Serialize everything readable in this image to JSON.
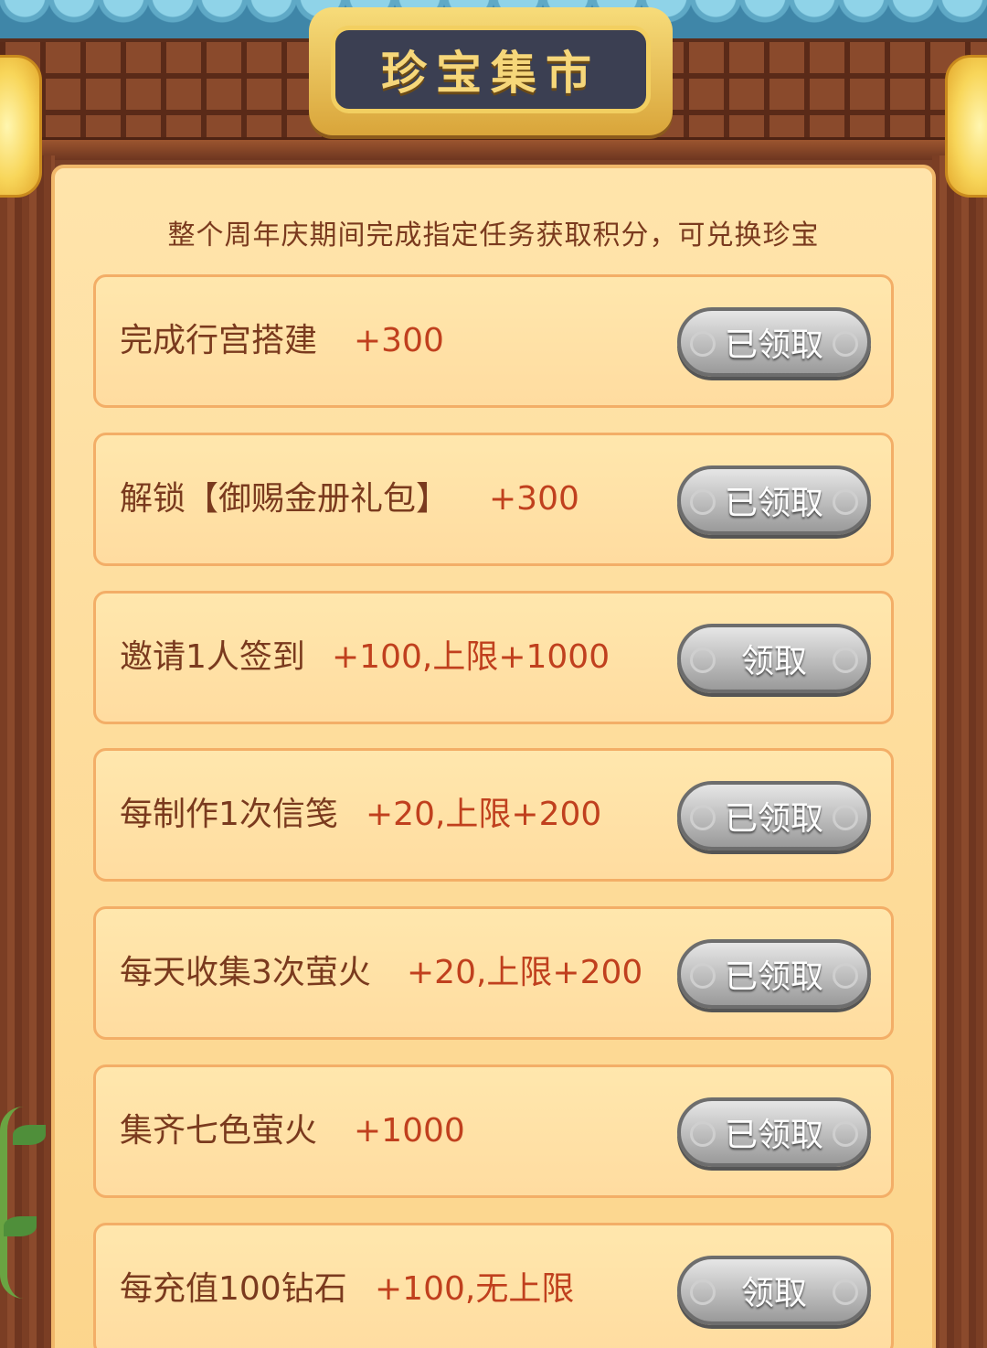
{
  "header": {
    "title": "珍宝集市"
  },
  "subtitle": "整个周年庆期间完成指定任务获取积分，可兑换珍宝",
  "tasks": [
    {
      "label": "完成行宫搭建",
      "points": "+300",
      "button": "已领取",
      "claimed": true
    },
    {
      "label": "解锁【御赐金册礼包】",
      "points": "+300",
      "button": "已领取",
      "claimed": true
    },
    {
      "label": "邀请1人签到",
      "points": "+100,上限+1000",
      "button": "领取",
      "claimed": false
    },
    {
      "label": "每制作1次信笺",
      "points": "+20,上限+200",
      "button": "已领取",
      "claimed": true
    },
    {
      "label": "每天收集3次萤火",
      "points": "+20,上限+200",
      "button": "已领取",
      "claimed": true
    },
    {
      "label": "集齐七色萤火",
      "points": "+1000",
      "button": "已领取",
      "claimed": true
    },
    {
      "label": "每充值100钻石",
      "points": "+100,无上限",
      "button": "领取",
      "claimed": false
    }
  ],
  "colors": {
    "task_text": "#7a3a1e",
    "points_text": "#c0401e",
    "panel_bg": "#ffe4ab",
    "button_grey": "#9a9a9a"
  }
}
